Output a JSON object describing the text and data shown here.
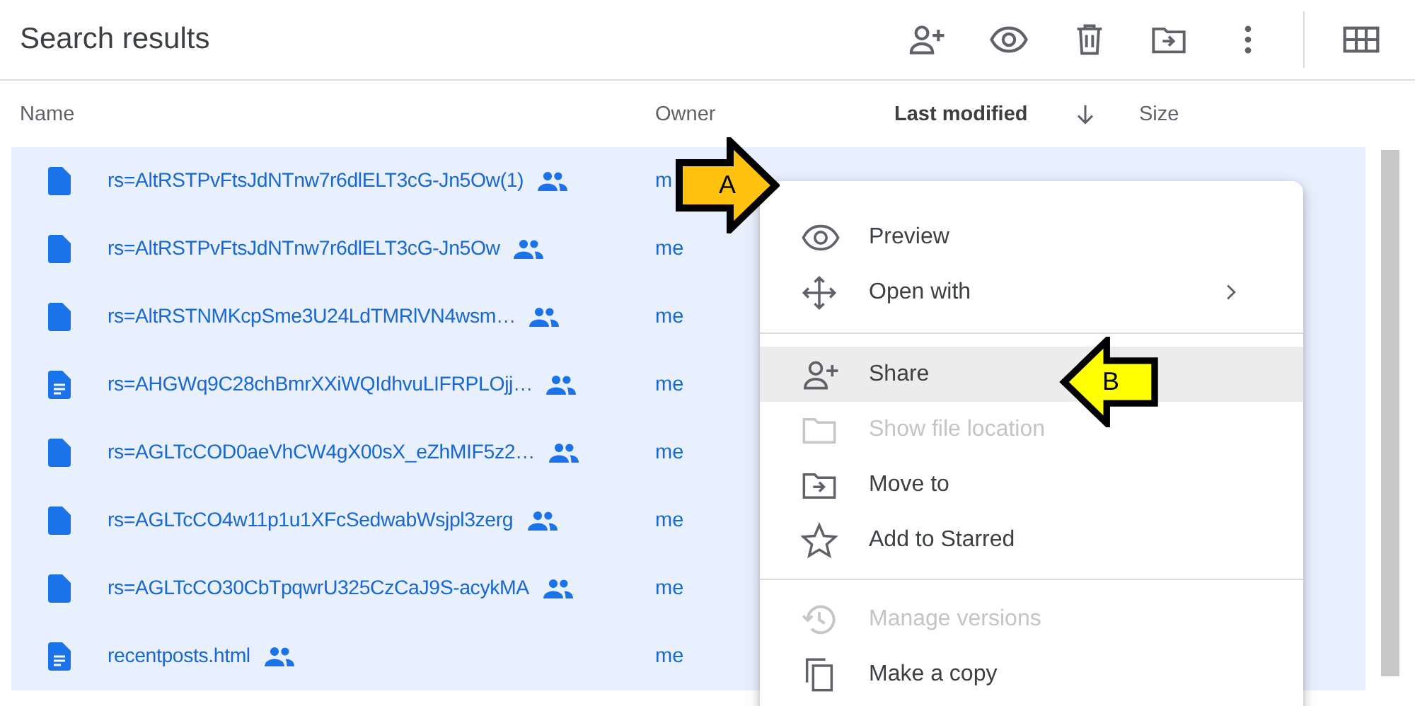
{
  "header": {
    "title": "Search results"
  },
  "columns": [
    {
      "label": "Name"
    },
    {
      "label": "Owner"
    },
    {
      "label": "Last modified",
      "sorted": true
    },
    {
      "label": "Size"
    }
  ],
  "rows": [
    {
      "kind": "file",
      "name": "rs=AltRSTPvFtsJdNTnw7r6dlELT3cG-Jn5Ow(1)",
      "shared": true,
      "owner": "m",
      "selected": true
    },
    {
      "kind": "file",
      "name": "rs=AltRSTPvFtsJdNTnw7r6dlELT3cG-Jn5Ow",
      "shared": true,
      "owner": "me",
      "selected": true
    },
    {
      "kind": "file",
      "name": "rs=AltRSTNMKcpSme3U24LdTMRlVN4wsm…",
      "shared": true,
      "owner": "me",
      "selected": true
    },
    {
      "kind": "document",
      "name": "rs=AHGWq9C28chBmrXXiWQIdhvuLIFRPLOjj…",
      "shared": true,
      "owner": "me",
      "selected": true
    },
    {
      "kind": "file",
      "name": "rs=AGLTcCOD0aeVhCW4gX00sX_eZhMIF5z2…",
      "shared": true,
      "owner": "me",
      "selected": true
    },
    {
      "kind": "file",
      "name": "rs=AGLTcCO4w11p1u1XFcSedwabWsjpl3zerg",
      "shared": true,
      "owner": "me",
      "selected": true
    },
    {
      "kind": "file",
      "name": "rs=AGLTcCO30CbTpqwrU325CzCaJ9S-acykMA",
      "shared": true,
      "owner": "me",
      "selected": true
    },
    {
      "kind": "document",
      "name": "recentposts.html",
      "shared": true,
      "owner": "me",
      "selected": true
    }
  ],
  "context_menu": {
    "items": [
      {
        "kind": "item",
        "label": "Preview",
        "disabled": false,
        "highlighted": false
      },
      {
        "kind": "item",
        "label": "Open with",
        "disabled": false,
        "highlighted": false,
        "submenu": true
      },
      {
        "kind": "divider"
      },
      {
        "kind": "item",
        "label": "Share",
        "disabled": false,
        "highlighted": true
      },
      {
        "kind": "item",
        "label": "Show file location",
        "disabled": true,
        "highlighted": false
      },
      {
        "kind": "item",
        "label": "Move to",
        "disabled": false,
        "highlighted": false
      },
      {
        "kind": "item",
        "label": "Add to Starred",
        "disabled": false,
        "highlighted": false
      },
      {
        "kind": "divider"
      },
      {
        "kind": "item",
        "label": "Manage versions",
        "disabled": true,
        "highlighted": false
      },
      {
        "kind": "item",
        "label": "Make a copy",
        "disabled": false,
        "highlighted": false
      }
    ]
  },
  "callouts": [
    {
      "label": "A",
      "kind": "right-arrow",
      "color": "#ffc20e"
    },
    {
      "label": "B",
      "kind": "left-arrow",
      "color": "#ffff00"
    }
  ]
}
